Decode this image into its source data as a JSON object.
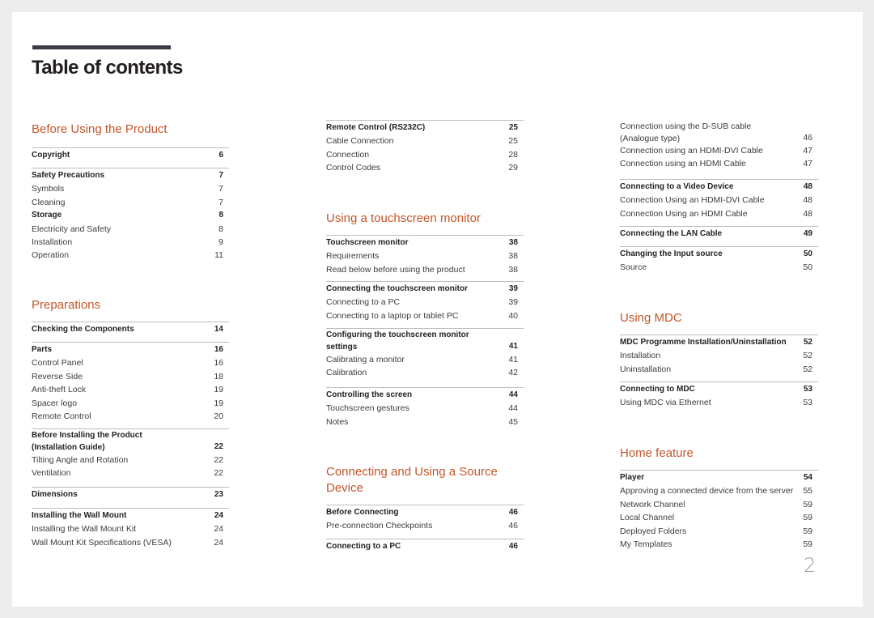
{
  "page": {
    "title": "Table of contents",
    "page_number": "2",
    "accent_color": "#c2572a"
  },
  "columns": [
    {
      "sections": [
        {
          "title": "Before Using the Product",
          "groups": [
            {
              "items": [
                {
                  "label": "Copyright",
                  "page": "6",
                  "bold": true
                }
              ]
            },
            {
              "items": [
                {
                  "label": "Safety Precautions",
                  "page": "7",
                  "bold": true
                },
                {
                  "label": "Symbols",
                  "page": "7"
                },
                {
                  "label": "Cleaning",
                  "page": "7"
                },
                {
                  "label": "Storage",
                  "page": "8",
                  "bold": true
                },
                {
                  "label": "Electricity and Safety",
                  "page": "8"
                },
                {
                  "label": "Installation",
                  "page": "9"
                },
                {
                  "label": "Operation",
                  "page": "11"
                }
              ]
            }
          ]
        },
        {
          "title": "Preparations",
          "groups": [
            {
              "items": [
                {
                  "label": "Checking the Components",
                  "page": "14",
                  "bold": true
                }
              ]
            },
            {
              "items": [
                {
                  "label": "Parts",
                  "page": "16",
                  "bold": true
                },
                {
                  "label": "Control Panel",
                  "page": "16"
                },
                {
                  "label": "Reverse Side",
                  "page": "18"
                },
                {
                  "label": "Anti-theft Lock",
                  "page": "19"
                },
                {
                  "label": "Spacer logo",
                  "page": "19"
                },
                {
                  "label": "Remote Control",
                  "page": "20"
                }
              ]
            },
            {
              "items": [
                {
                  "label": "Before Installing the Product (Installation Guide)",
                  "page": "22",
                  "bold": true
                },
                {
                  "label": "Tilting Angle and Rotation",
                  "page": "22"
                },
                {
                  "label": "Ventilation",
                  "page": "22"
                }
              ]
            },
            {
              "items": [
                {
                  "label": "Dimensions",
                  "page": "23",
                  "bold": true
                }
              ]
            },
            {
              "items": [
                {
                  "label": "Installing the Wall Mount",
                  "page": "24",
                  "bold": true
                },
                {
                  "label": "Installing the Wall Mount Kit",
                  "page": "24"
                },
                {
                  "label": "Wall Mount Kit Specifications (VESA)",
                  "page": "24"
                }
              ]
            }
          ]
        }
      ]
    },
    {
      "sections": [
        {
          "title": "",
          "groups": [
            {
              "items": [
                {
                  "label": "Remote Control (RS232C)",
                  "page": "25",
                  "bold": true
                },
                {
                  "label": "Cable Connection",
                  "page": "25"
                },
                {
                  "label": "Connection",
                  "page": "28"
                },
                {
                  "label": "Control Codes",
                  "page": "29"
                }
              ]
            }
          ]
        },
        {
          "title": "Using a touchscreen monitor",
          "groups": [
            {
              "items": [
                {
                  "label": "Touchscreen monitor",
                  "page": "38",
                  "bold": true
                },
                {
                  "label": "Requirements",
                  "page": "38"
                },
                {
                  "label": "Read below before using the product",
                  "page": "38"
                }
              ]
            },
            {
              "items": [
                {
                  "label": "Connecting the touchscreen monitor",
                  "page": "39",
                  "bold": true
                },
                {
                  "label": "Connecting to a PC",
                  "page": "39"
                },
                {
                  "label": "Connecting to a laptop or tablet PC",
                  "page": "40"
                }
              ]
            },
            {
              "items": [
                {
                  "label": "Configuring the touchscreen monitor settings",
                  "page": "41",
                  "bold": true
                },
                {
                  "label": "Calibrating a monitor",
                  "page": "41"
                },
                {
                  "label": "Calibration",
                  "page": "42"
                }
              ]
            },
            {
              "items": [
                {
                  "label": "Controlling the screen",
                  "page": "44",
                  "bold": true
                },
                {
                  "label": "Touchscreen gestures",
                  "page": "44"
                },
                {
                  "label": "Notes",
                  "page": "45"
                }
              ]
            }
          ]
        },
        {
          "title": "Connecting and Using a Source Device",
          "groups": [
            {
              "items": [
                {
                  "label": "Before Connecting",
                  "page": "46",
                  "bold": true
                },
                {
                  "label": "Pre-connection Checkpoints",
                  "page": "46"
                }
              ]
            },
            {
              "items": [
                {
                  "label": "Connecting to a PC",
                  "page": "46",
                  "bold": true
                }
              ]
            }
          ]
        }
      ]
    },
    {
      "sections": [
        {
          "title": "",
          "groups": [
            {
              "items": [
                {
                  "label": "Connection using the D-SUB cable (Analogue type)",
                  "page": "46"
                },
                {
                  "label": "Connection using an HDMI-DVI Cable",
                  "page": "47"
                },
                {
                  "label": "Connection using an HDMI Cable",
                  "page": "47"
                }
              ]
            },
            {
              "items": [
                {
                  "label": "Connecting to a Video Device",
                  "page": "48",
                  "bold": true
                },
                {
                  "label": "Connection Using an HDMI-DVI Cable",
                  "page": "48"
                },
                {
                  "label": "Connection Using an HDMI Cable",
                  "page": "48"
                }
              ]
            },
            {
              "items": [
                {
                  "label": "Connecting the LAN Cable",
                  "page": "49",
                  "bold": true
                }
              ]
            },
            {
              "items": [
                {
                  "label": "Changing the Input source",
                  "page": "50",
                  "bold": true
                },
                {
                  "label": "Source",
                  "page": "50"
                }
              ]
            }
          ]
        },
        {
          "title": "Using MDC",
          "groups": [
            {
              "items": [
                {
                  "label": "MDC Programme Installation/Uninstallation",
                  "page": "52",
                  "bold": true
                },
                {
                  "label": "Installation",
                  "page": "52"
                },
                {
                  "label": "Uninstallation",
                  "page": "52"
                }
              ]
            },
            {
              "items": [
                {
                  "label": "Connecting to MDC",
                  "page": "53",
                  "bold": true
                },
                {
                  "label": "Using MDC via Ethernet",
                  "page": "53"
                }
              ]
            }
          ]
        },
        {
          "title": "Home feature",
          "groups": [
            {
              "items": [
                {
                  "label": "Player",
                  "page": "54",
                  "bold": true
                },
                {
                  "label": "Approving a connected device from the server",
                  "page": "55"
                },
                {
                  "label": "Network Channel",
                  "page": "59"
                },
                {
                  "label": "Local Channel",
                  "page": "59"
                },
                {
                  "label": "Deployed Folders",
                  "page": "59"
                },
                {
                  "label": "My Templates",
                  "page": "59"
                }
              ]
            }
          ]
        }
      ]
    }
  ]
}
